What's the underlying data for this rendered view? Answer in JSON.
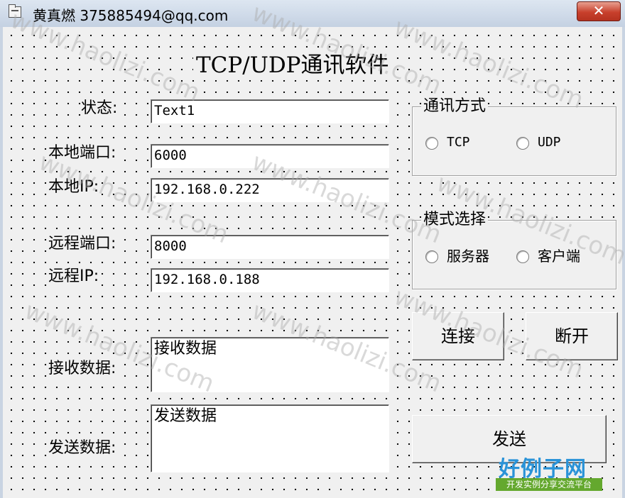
{
  "window": {
    "title": "黄真燃 375885494@qq.com",
    "app_icon": "form-window-icon",
    "close_glyph": "✕"
  },
  "form": {
    "heading": "TCP/UDP通讯软件",
    "status_label": "状态:",
    "status_value": "Text1",
    "local_port_label": "本地端口:",
    "local_port_value": "6000",
    "local_ip_label": "本地IP:",
    "local_ip_value": "192.168.0.222",
    "remote_port_label": "远程端口:",
    "remote_port_value": "8000",
    "remote_ip_label": "远程IP:",
    "remote_ip_value": "192.168.0.188",
    "receive_label": "接收数据:",
    "receive_value": "接收数据",
    "send_label": "发送数据:",
    "send_value": "发送数据"
  },
  "protocol_frame": {
    "title": "通讯方式",
    "options": [
      {
        "label": "TCP",
        "selected": false
      },
      {
        "label": "UDP",
        "selected": false
      }
    ]
  },
  "mode_frame": {
    "title": "模式选择",
    "options": [
      {
        "label": "服务器",
        "selected": false
      },
      {
        "label": "客户端",
        "selected": false
      }
    ]
  },
  "buttons": {
    "connect": "连接",
    "disconnect": "断开",
    "send": "发送"
  },
  "watermark": {
    "text": "www.haolizi.com",
    "logo_main": "好例子网",
    "logo_sub": "开发实例分享交流平台"
  },
  "colors": {
    "close_button": "#c8402c",
    "logo_blue": "#2a93d8",
    "logo_green": "#64a82e"
  }
}
